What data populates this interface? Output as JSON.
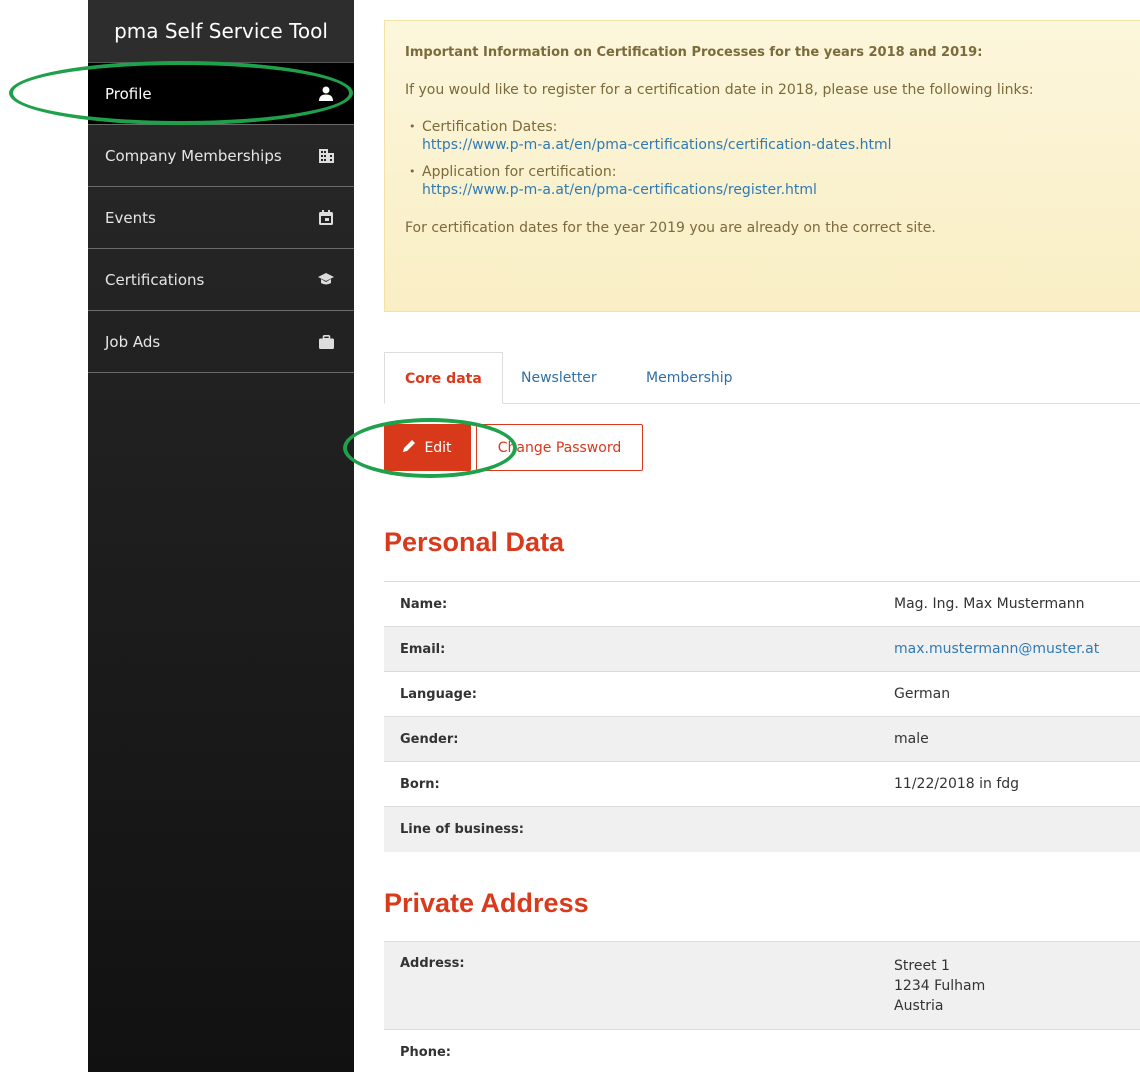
{
  "app": {
    "title": "pma Self Service Tool"
  },
  "sidebar": {
    "items": [
      {
        "label": "Profile",
        "icon": "user-icon",
        "active": true
      },
      {
        "label": "Company Memberships",
        "icon": "building-icon",
        "active": false
      },
      {
        "label": "Events",
        "icon": "calendar-icon",
        "active": false
      },
      {
        "label": "Certifications",
        "icon": "graduation-cap-icon",
        "active": false
      },
      {
        "label": "Job Ads",
        "icon": "briefcase-icon",
        "active": false
      }
    ]
  },
  "alert": {
    "title": "Important Information on Certification Processes for the years 2018 and 2019:",
    "intro": "If you would like to register for a certification date in 2018, please use the following links:",
    "links": [
      {
        "label": "Certification Dates:",
        "url": "https://www.p-m-a.at/en/pma-certifications/certification-dates.html"
      },
      {
        "label": "Application for certification:",
        "url": "https://www.p-m-a.at/en/pma-certifications/register.html"
      }
    ],
    "footer": "For certification dates for the year 2019 you are already on the correct site."
  },
  "tabs": [
    {
      "label": "Core data",
      "active": true
    },
    {
      "label": "Newsletter",
      "active": false
    },
    {
      "label": "Membership",
      "active": false
    }
  ],
  "actions": {
    "edit_label": "Edit",
    "change_password_label": "Change Password"
  },
  "personal": {
    "heading": "Personal Data",
    "rows": [
      {
        "label": "Name:",
        "value": "Mag. Ing. Max Mustermann"
      },
      {
        "label": "Email:",
        "value": "max.mustermann@muster.at"
      },
      {
        "label": "Language:",
        "value": "German"
      },
      {
        "label": "Gender:",
        "value": "male"
      },
      {
        "label": "Born:",
        "value": "11/22/2018 in fdg"
      },
      {
        "label": "Line of business:",
        "value": ""
      }
    ]
  },
  "address": {
    "heading": "Private Address",
    "rows": [
      {
        "label": "Address:",
        "lines": [
          "Street 1",
          "1234 Fulham",
          "Austria"
        ]
      },
      {
        "label": "Phone:",
        "value": ""
      }
    ]
  },
  "colors": {
    "accent": "#d8391b",
    "link": "#2f7ab5",
    "annotation": "#1fa04a",
    "alert_bg": "#fcf6dc"
  }
}
